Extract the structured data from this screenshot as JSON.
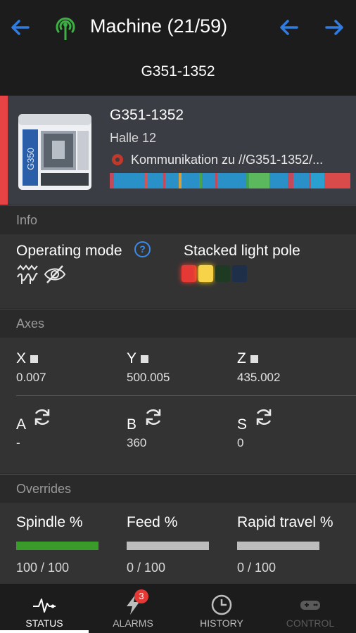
{
  "header": {
    "title": "Machine (21/59)",
    "subtitle": "G351-1352",
    "icons": [
      "back-arrow-icon",
      "signal-tower-icon",
      "prev-arrow-icon",
      "next-arrow-icon"
    ],
    "accent_color": "#2f7de1",
    "signal_color": "#3cb043"
  },
  "machine_card": {
    "name": "G351-1352",
    "location": "Halle 12",
    "message": "Kommunikation zu //G351-1352/...",
    "status_color": "#e64444",
    "status_timeline_colors": [
      "#c34a5b",
      "#2a90c8",
      "#d25559",
      "#2a90c8",
      "#c34a5b",
      "#2a90c8",
      "#d5a040",
      "#2a90c8",
      "#4aa34a",
      "#2a90c8",
      "#c34a5b",
      "#2a90c8",
      "#3fa35a",
      "#5cb85c",
      "#2a90c8",
      "#c34a5b",
      "#2a90c8",
      "#c84b55",
      "#2aa0d0",
      "#d94a4a"
    ]
  },
  "info": {
    "section_label": "Info",
    "operating_mode_label": "Operating mode",
    "operating_mode_icons": [
      "waveform-icon",
      "eye-off-icon"
    ],
    "help_icon": "help-icon",
    "light_pole_label": "Stacked light pole",
    "light_pole_lamps": [
      {
        "color": "red",
        "on": true
      },
      {
        "color": "yellow",
        "on": true
      },
      {
        "color": "green",
        "on": false
      },
      {
        "color": "blue",
        "on": false
      }
    ]
  },
  "axes": {
    "section_label": "Axes",
    "linear": [
      {
        "name": "X",
        "value": "0.007"
      },
      {
        "name": "Y",
        "value": "500.005"
      },
      {
        "name": "Z",
        "value": "435.002"
      }
    ],
    "rotary": [
      {
        "name": "A",
        "value": "-"
      },
      {
        "name": "B",
        "value": "360"
      },
      {
        "name": "S",
        "value": "0"
      }
    ]
  },
  "overrides": {
    "section_label": "Overrides",
    "items": [
      {
        "label": "Spindle %",
        "value": "100 / 100",
        "fraction": 1.0,
        "color": "#3a9a2a"
      },
      {
        "label": "Feed %",
        "value": "0 / 100",
        "fraction": 0.0,
        "color": "#bdbdbd"
      },
      {
        "label": "Rapid travel %",
        "value": "0 / 100",
        "fraction": 0.0,
        "color": "#bdbdbd"
      }
    ]
  },
  "tabs": [
    {
      "label": "STATUS",
      "icon": "pulse-icon",
      "active": true
    },
    {
      "label": "ALARMS",
      "icon": "lightning-icon",
      "badge": "3",
      "active": false
    },
    {
      "label": "HISTORY",
      "icon": "clock-icon",
      "active": false
    },
    {
      "label": "CONTROL",
      "icon": "gamepad-icon",
      "active": false,
      "disabled": true
    }
  ]
}
